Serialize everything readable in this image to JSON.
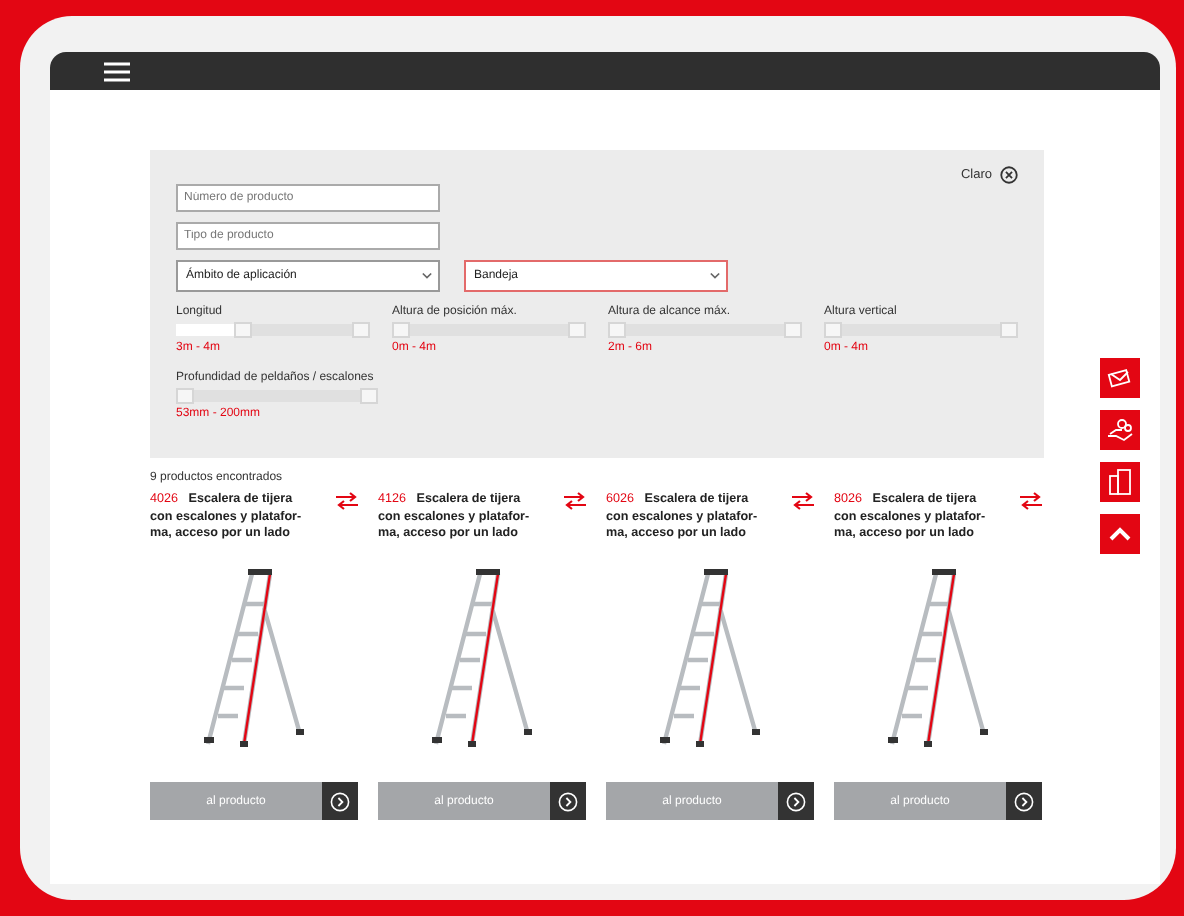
{
  "filters": {
    "clear": "Claro",
    "fields": [
      {
        "placeholder": "Número de producto"
      },
      {
        "placeholder": "Tipo de producto"
      }
    ],
    "selects": [
      {
        "value": "Ámbito de aplicación",
        "highlighted": false
      },
      {
        "value": "Bandeja",
        "highlighted": true
      }
    ],
    "sliders": [
      {
        "label": "Longitud",
        "level": 0.33,
        "reading": "3m - 4m"
      },
      {
        "label": "Altura de posición máx.",
        "level": 0,
        "reading": "0m - 4m"
      },
      {
        "label": "Altura de alcance máx.",
        "level": 0,
        "reading": "2m - 6m"
      },
      {
        "label": "Altura vertical",
        "level": 0,
        "reading": "0m - 4m"
      },
      {
        "label": "Profundidad de peldaños / escalones",
        "level": 0,
        "reading": "53mm - 200mm"
      }
    ]
  },
  "results": {
    "count": "9 productos encontrados",
    "products": [
      {
        "code": "4026",
        "title": "Escalera de tijera con escalones y platafor-ma, acceso por un lado",
        "button": "al producto"
      },
      {
        "code": "4126",
        "title": "Escalera de tijera con escalones y platafor-ma, acceso por un lado",
        "button": "al producto"
      },
      {
        "code": "6026",
        "title": "Escalera de tijera con escalones y platafor-ma, acceso por un lado",
        "button": "al producto"
      },
      {
        "code": "8026",
        "title": "Escalera de tijera con escalones y platafor-ma, acceso por un lado",
        "button": "al producto"
      }
    ]
  }
}
